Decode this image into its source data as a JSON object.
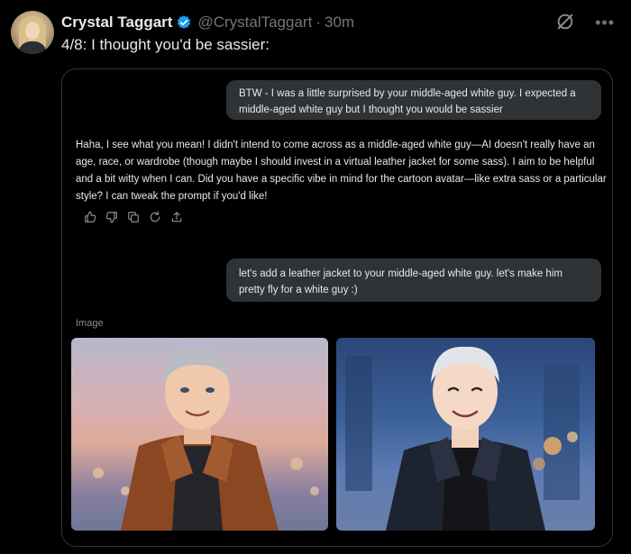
{
  "user": {
    "name": "Crystal Taggart",
    "handle": "@CrystalTaggart",
    "separator": "·",
    "time": "30m"
  },
  "tweet": {
    "text": "4/8: I thought you'd be sassier:"
  },
  "icons": {
    "verified": "verified-badge-icon",
    "grok": "grok-icon",
    "more": "more-options-icon"
  },
  "colors": {
    "background": "#000000",
    "verified": "#1d9bf0",
    "bubble": "#2f3336",
    "muted": "#71767b"
  },
  "chat": {
    "user_message_1": "BTW - I was a little surprised by your middle-aged white guy. I expected a middle-aged white guy but I thought you would be sassier",
    "response": "Haha, I see what you mean! I didn't intend to come across as a middle-aged white guy—AI doesn't really have an age, race, or wardrobe (though maybe I should invest in a virtual leather jacket for some sass). I aim to be helpful and a bit witty when I can. Did you have a specific vibe in mind for the cartoon avatar—like extra sass or a particular style? I can tweak the prompt if you'd like!",
    "user_message_2": "let's add a leather jacket to your middle-aged white guy. let's make him pretty fly for a white guy :)",
    "image_label": "Image",
    "action_icons": [
      "thumbs-up-icon",
      "thumbs-down-icon",
      "copy-icon",
      "regenerate-icon",
      "share-icon"
    ]
  },
  "images": [
    {
      "name": "cartoon-man-brown-leather-jacket"
    },
    {
      "name": "cartoon-man-black-leather-jacket"
    }
  ]
}
